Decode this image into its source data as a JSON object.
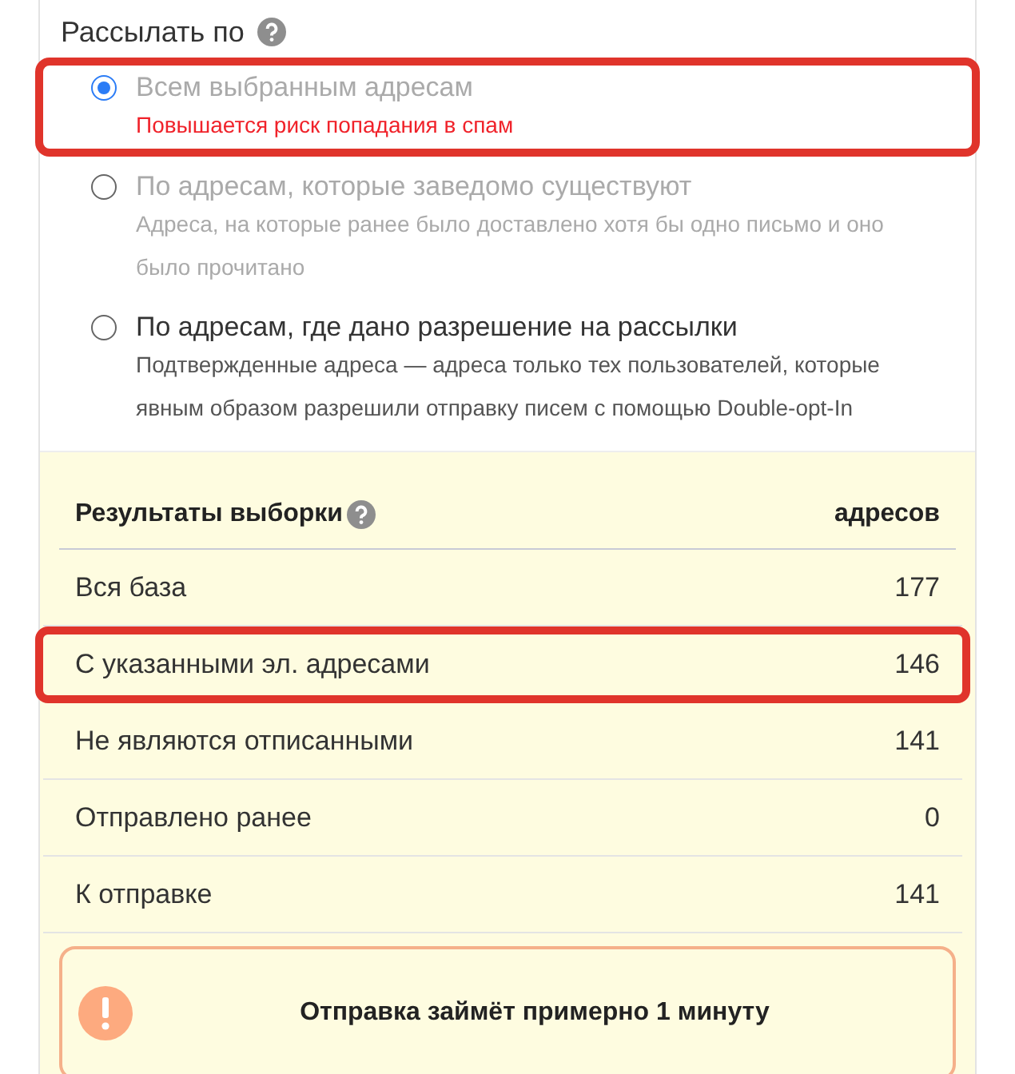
{
  "send_by": {
    "title": "Рассылать по",
    "options": [
      {
        "label": "Всем выбранным адресам",
        "note": "Повышается риск попадания в спам",
        "kind": "warning",
        "selected": true,
        "disabled": true,
        "highlighted": true
      },
      {
        "label": "По адресам, которые заведомо существуют",
        "note": "Адреса, на которые ранее было доставлено хотя бы одно письмо и оно было прочитано",
        "kind": "hint",
        "selected": false,
        "disabled": true,
        "highlighted": false
      },
      {
        "label": "По адресам, где дано разрешение на рассылки",
        "note": "Подтвержденные адреса — адреса только тех пользователей, которые явным образом разрешили отправку писем с помощью Double-opt-In",
        "kind": "hint",
        "selected": false,
        "disabled": false,
        "highlighted": false
      }
    ]
  },
  "results": {
    "title": "Результаты выборки",
    "column": "адресов",
    "rows": [
      {
        "label": "Вся база",
        "value": "177",
        "highlighted": false
      },
      {
        "label": "С указанными эл. адресами",
        "value": "146",
        "highlighted": true
      },
      {
        "label": "Не являются отписанными",
        "value": "141",
        "highlighted": false
      },
      {
        "label": "Отправлено ранее",
        "value": "0",
        "highlighted": false
      },
      {
        "label": "К отправке",
        "value": "141",
        "highlighted": false
      }
    ],
    "alert": "Отправка займёт примерно 1 минуту"
  }
}
